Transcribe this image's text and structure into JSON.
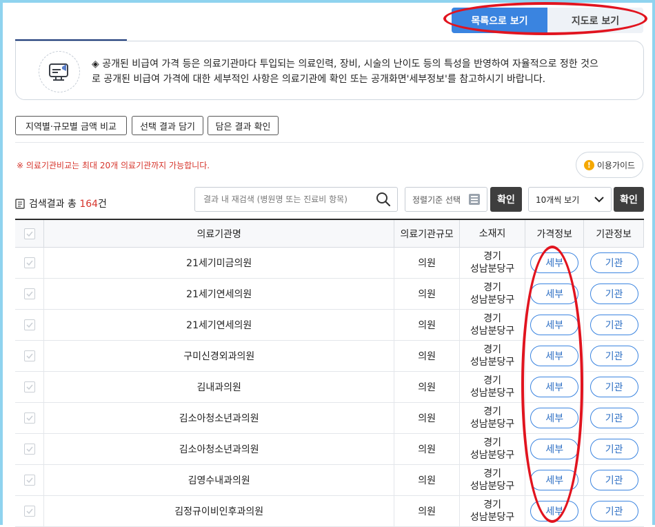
{
  "view_toggle": {
    "list": "목록으로 보기",
    "map": "지도로 보기"
  },
  "notice": {
    "line1": "◈ 공개된 비급여 가격 등은 의료기관마다 투입되는 의료인력, 장비, 시술의 난이도 등의 특성을 반영하여 자율적으로 정한 것으",
    "line2": "로 공개된 비급여 가격에 대한 세부적인 사항은 의료기관에 확인 또는 공개화면'세부정보'를 참고하시기 바랍니다."
  },
  "actions": {
    "compare": "지역별·규모별 금액 비교",
    "add_selected": "선택 결과 담기",
    "view_saved": "담은 결과 확인"
  },
  "warning": "※ 의료기관비교는 최대 20개 의료기관까지 가능합니다.",
  "guide_label": "이용가이드",
  "results": {
    "prefix": "검색결과 총 ",
    "count": "164",
    "suffix": "건"
  },
  "search": {
    "placeholder": "결과 내 재검색 (병원명 또는 진료비 항목)"
  },
  "sort": {
    "placeholder": "정렬기준 선택",
    "confirm": "확인"
  },
  "per_page": {
    "selected": "10개씩 보기",
    "confirm": "확인"
  },
  "table": {
    "headers": [
      "의료기관명",
      "의료기관규모",
      "소재지",
      "가격정보",
      "기관정보"
    ],
    "detail_btn": "세부",
    "org_btn": "기관",
    "rows": [
      {
        "name": "21세기미금의원",
        "size": "의원",
        "location": "경기 성남분당구"
      },
      {
        "name": "21세기연세의원",
        "size": "의원",
        "location": "경기 성남분당구"
      },
      {
        "name": "21세기연세의원",
        "size": "의원",
        "location": "경기 성남분당구"
      },
      {
        "name": "구미신경외과의원",
        "size": "의원",
        "location": "경기 성남분당구"
      },
      {
        "name": "김내과의원",
        "size": "의원",
        "location": "경기 성남분당구"
      },
      {
        "name": "김소아청소년과의원",
        "size": "의원",
        "location": "경기 성남분당구"
      },
      {
        "name": "김소아청소년과의원",
        "size": "의원",
        "location": "경기 성남분당구"
      },
      {
        "name": "김영수내과의원",
        "size": "의원",
        "location": "경기 성남분당구"
      },
      {
        "name": "김정규이비인후과의원",
        "size": "의원",
        "location": "경기 성남분당구"
      }
    ]
  },
  "colors": {
    "accent": "#3a84e0",
    "annotation": "#e1141f",
    "warning": "#d6342b"
  }
}
